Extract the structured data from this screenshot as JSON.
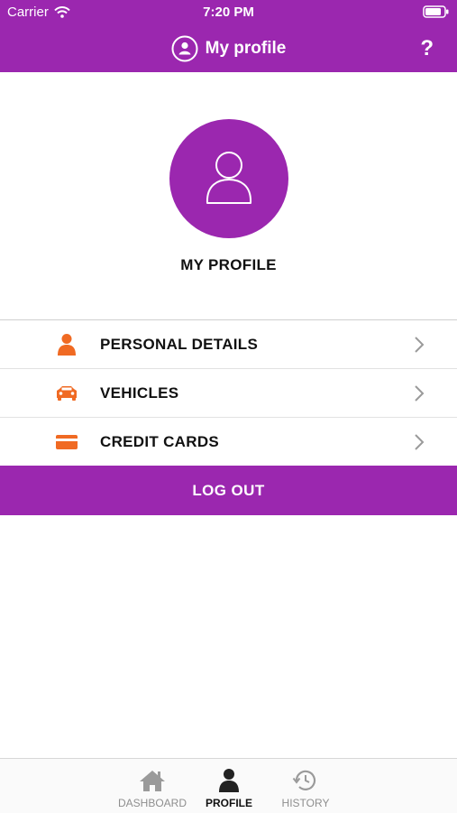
{
  "status_bar": {
    "carrier": "Carrier",
    "time": "7:20 PM"
  },
  "header": {
    "title": "My profile",
    "help": "?"
  },
  "profile": {
    "label": "MY PROFILE"
  },
  "menu": {
    "items": [
      {
        "label": "PERSONAL DETAILS",
        "icon": "person-icon"
      },
      {
        "label": "VEHICLES",
        "icon": "car-icon"
      },
      {
        "label": "CREDIT CARDS",
        "icon": "credit-card-icon"
      }
    ]
  },
  "logout": {
    "label": "LOG OUT"
  },
  "tabs": [
    {
      "label": "DASHBOARD",
      "icon": "home-icon",
      "active": false
    },
    {
      "label": "PROFILE",
      "icon": "person-icon",
      "active": true
    },
    {
      "label": "HISTORY",
      "icon": "history-icon",
      "active": false
    }
  ],
  "colors": {
    "brand": "#9b27af",
    "accent": "#f06a23"
  }
}
